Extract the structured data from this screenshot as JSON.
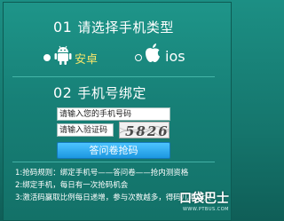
{
  "step1": {
    "number": "01",
    "title": "请选择手机类型"
  },
  "os_options": [
    {
      "label": "安卓",
      "icon": "android-icon",
      "selected": true
    },
    {
      "label": "ios",
      "icon": "apple-icon",
      "selected": false
    }
  ],
  "step2": {
    "number": "02",
    "title": "手机号绑定"
  },
  "form": {
    "phone_placeholder": "请输入您的手机号码",
    "code_placeholder": "请输入验证码",
    "captcha_text": "5826",
    "submit_label": "答问卷抢码"
  },
  "rules": [
    "1:抢码规则：绑定手机号——答问卷——抢内测资格",
    "2:绑定手机，每日有一次抢码机会",
    "3:激活码赢取比例每日递增，参与次数越多，得码几率越大"
  ],
  "watermark": {
    "logo": "口袋巴士",
    "url": "WWW.PTBUS.COM"
  },
  "colors": {
    "background": "#178077",
    "selected_label": "#f3e46a",
    "button": "#1c97e0"
  }
}
